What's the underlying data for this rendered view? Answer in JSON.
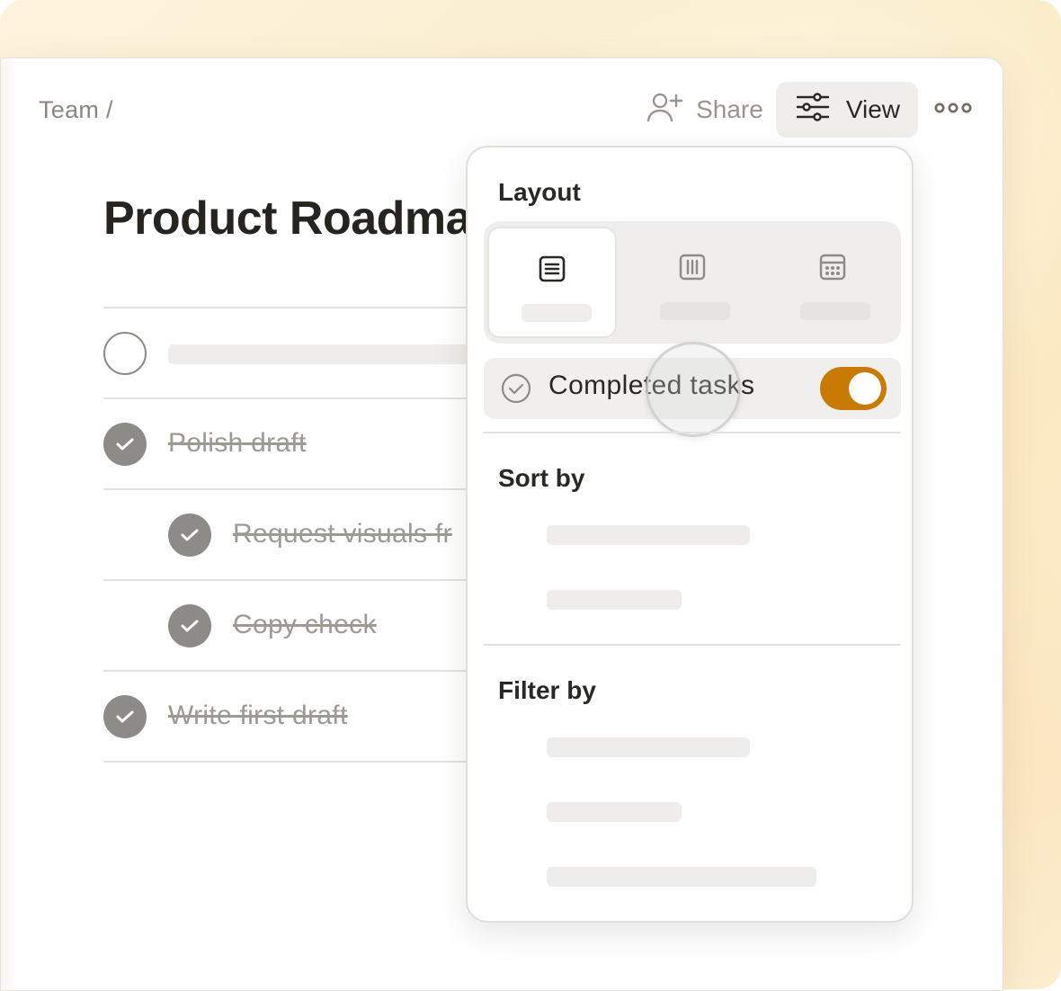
{
  "breadcrumb": "Team /",
  "header": {
    "share_label": "Share",
    "view_label": "View"
  },
  "page": {
    "title": "Product Roadma"
  },
  "tasks": [
    {
      "label": "",
      "done": false
    },
    {
      "label": "Polish draft",
      "done": true
    },
    {
      "label": "Request visuals fr",
      "done": true,
      "indent": true
    },
    {
      "label": "Copy check",
      "done": true,
      "indent": true
    },
    {
      "label": "Write first draft",
      "done": true
    }
  ],
  "view_panel": {
    "layout_heading": "Layout",
    "layout_options": [
      {
        "icon": "list-icon",
        "active": true
      },
      {
        "icon": "board-icon",
        "active": false
      },
      {
        "icon": "calendar-icon",
        "active": false
      }
    ],
    "completed_tasks_label": "Completed tasks",
    "completed_tasks_enabled": true,
    "sort_heading": "Sort by",
    "filter_heading": "Filter by"
  },
  "colors": {
    "accent": "#c97a05",
    "background": "#fbeecd"
  }
}
